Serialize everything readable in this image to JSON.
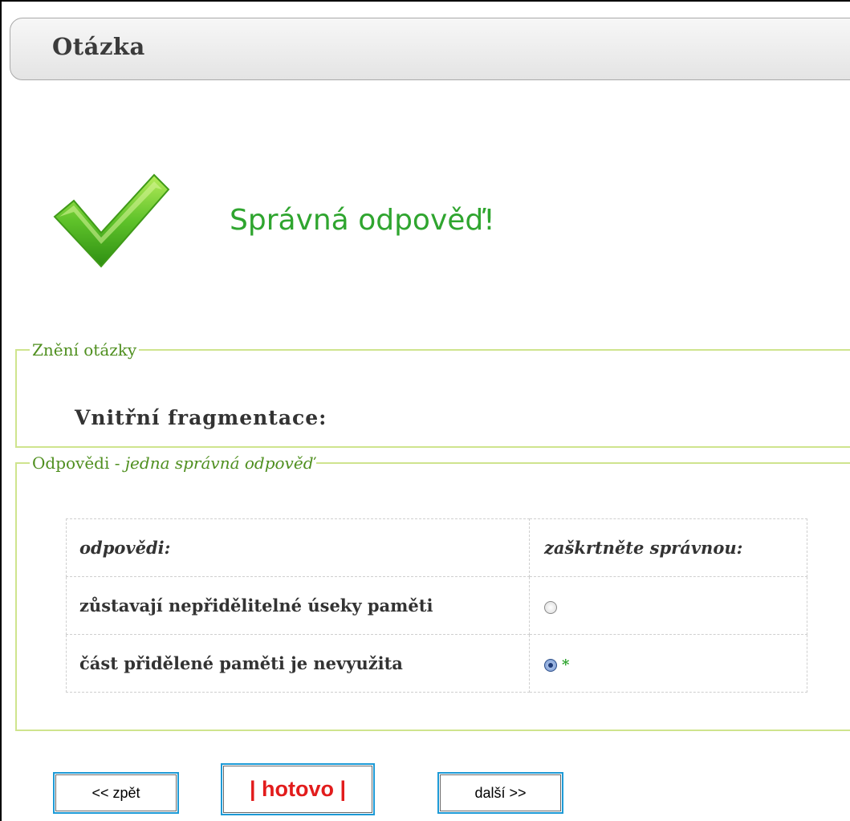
{
  "header": {
    "title": "Otázka"
  },
  "result": {
    "icon": "checkmark-icon",
    "text": "Správná odpověď!",
    "color": "#2fa52f"
  },
  "question_box": {
    "legend": "Znění otázky",
    "question": "Vnitřní fragmentace:"
  },
  "answers_box": {
    "legend_prefix": "Odpovědi - ",
    "legend_italic": "jedna správná odpověď",
    "columns": [
      "odpovědi:",
      "zaškrtněte správnou:"
    ],
    "rows": [
      {
        "text": "zůstavají nepřidělitelné úseky paměti",
        "selected": false,
        "marker": ""
      },
      {
        "text": "část přidělené paměti je nevyužita",
        "selected": true,
        "marker": "*"
      }
    ]
  },
  "buttons": {
    "back": "<< zpět",
    "done": "| hotovo |",
    "next": "další >>"
  },
  "colors": {
    "accent_border": "#cfe48e",
    "legend_text": "#4f8f1f",
    "button_border": "#1d9ad6",
    "done_text": "#e21c1c"
  }
}
